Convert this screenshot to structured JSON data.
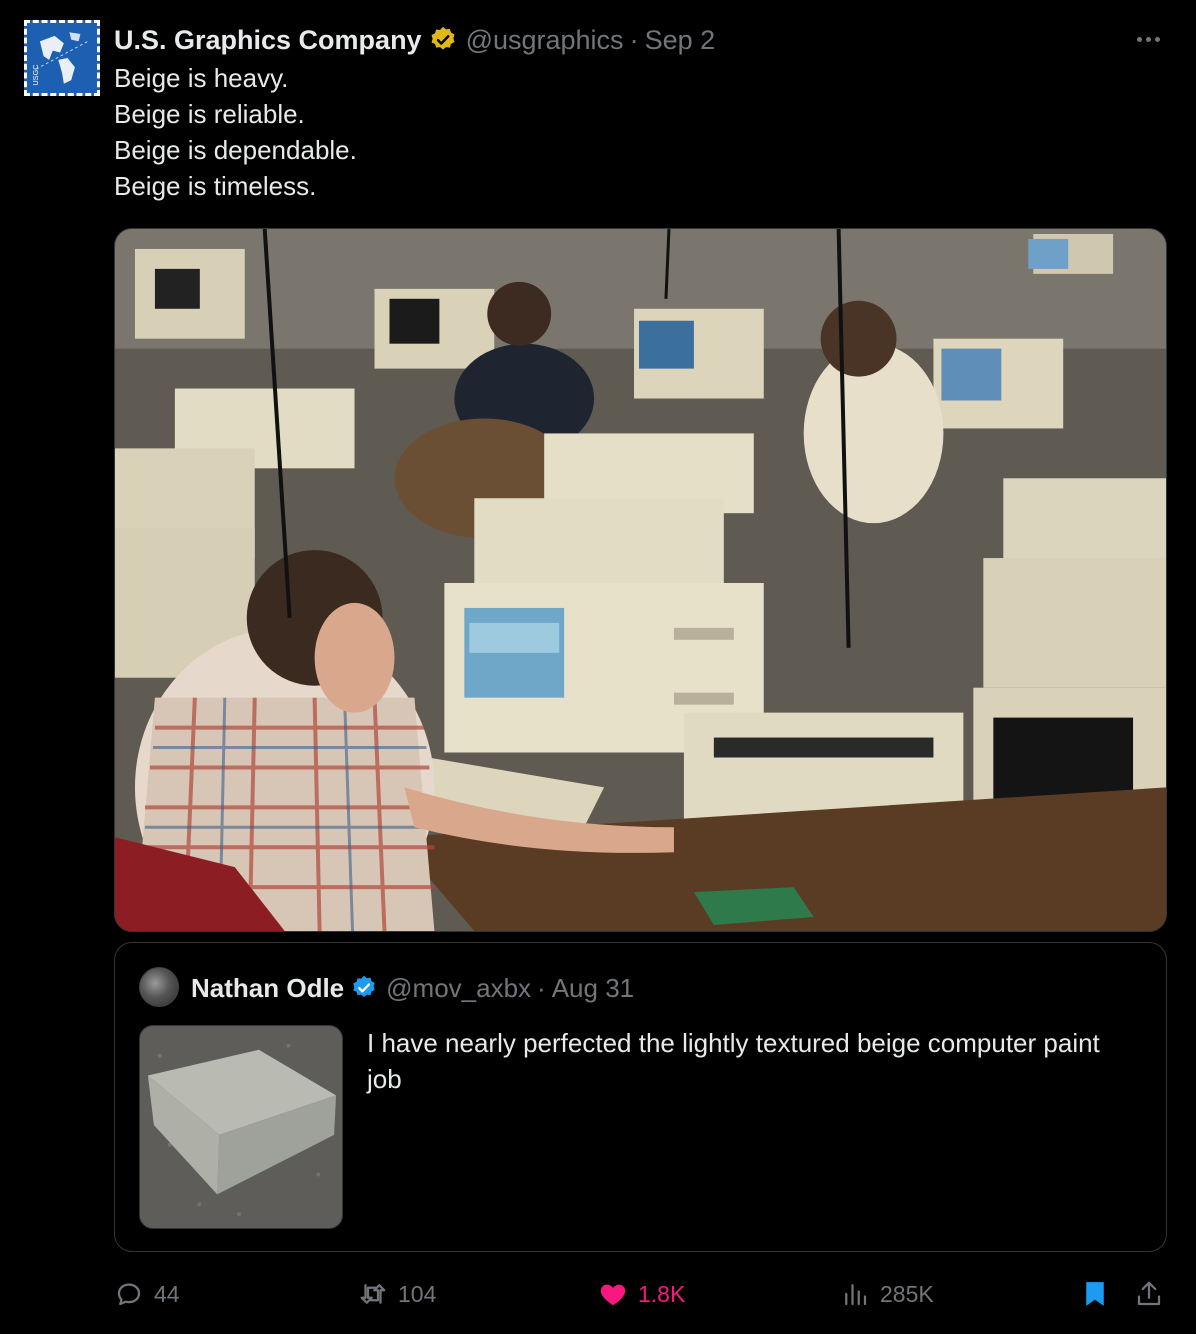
{
  "tweet": {
    "author_name": "U.S. Graphics Company",
    "author_handle": "@usgraphics",
    "separator": "·",
    "date": "Sep 2",
    "avatar_icon": "usgc-map-stamp-icon",
    "badge_icon": "gold-verified-badge-icon",
    "badge_color": "#e2b719",
    "text_lines": [
      "Beige is heavy.",
      "Beige is reliable.",
      "Beige is dependable.",
      "Beige is timeless."
    ],
    "media_description_icon": "photo"
  },
  "quote": {
    "author_name": "Nathan Odle",
    "author_handle": "@mov_axbx",
    "separator": "·",
    "date": "Aug 31",
    "badge_icon": "blue-verified-badge-icon",
    "badge_color": "#1d9bf0",
    "text": "I have nearly perfected the lightly textured beige computer paint job"
  },
  "actions": {
    "reply": {
      "icon": "reply-icon",
      "count": "44"
    },
    "retweet": {
      "icon": "retweet-icon",
      "count": "104"
    },
    "like": {
      "icon": "heart-icon",
      "count": "1.8K",
      "color": "#f91880"
    },
    "views": {
      "icon": "views-icon",
      "count": "285K"
    },
    "bookmark": {
      "icon": "bookmark-icon",
      "color": "#1d9bf0"
    },
    "share": {
      "icon": "share-icon"
    }
  },
  "colors": {
    "background": "#000000",
    "text_primary": "#e7e9ea",
    "text_secondary": "#71767b",
    "border": "#333639"
  }
}
